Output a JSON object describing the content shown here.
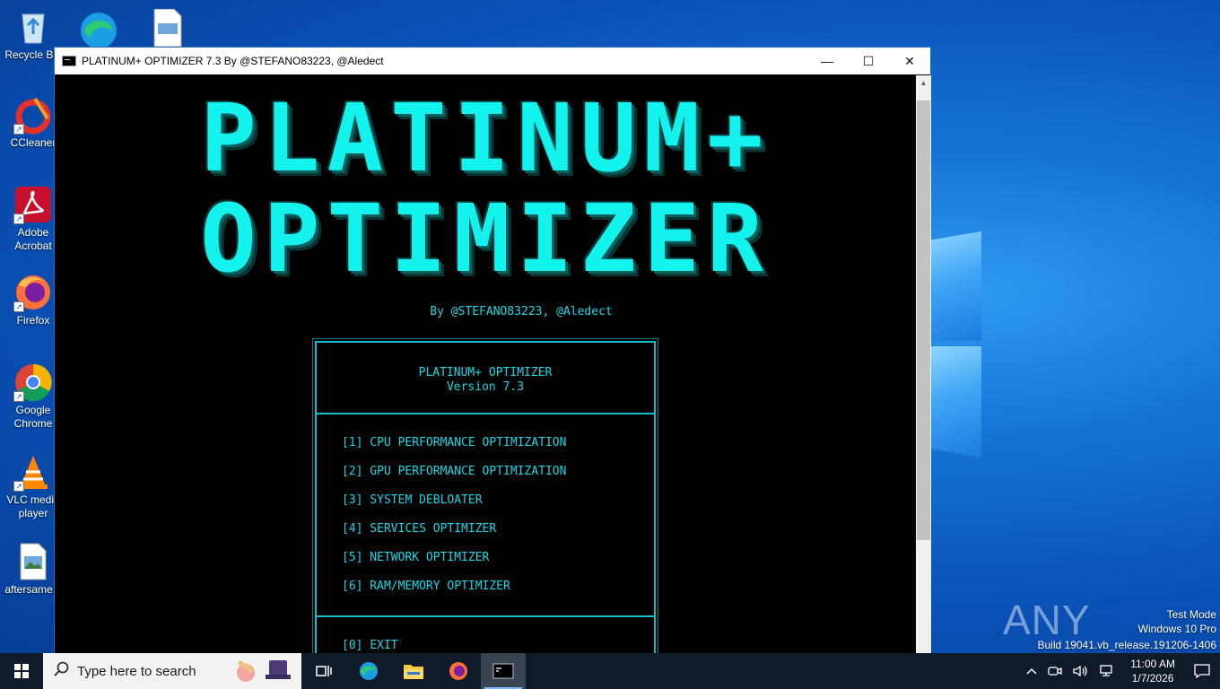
{
  "desktop": {
    "icons": [
      {
        "label": "Recycle Bin",
        "icon": "recycle-bin-icon"
      },
      {
        "label": "CCleaner",
        "icon": "ccleaner-icon"
      },
      {
        "label": "Adobe Acrobat",
        "icon": "acrobat-icon"
      },
      {
        "label": "Firefox",
        "icon": "firefox-icon"
      },
      {
        "label": "Google Chrome",
        "icon": "chrome-icon"
      },
      {
        "label": "VLC media player",
        "icon": "vlc-icon"
      },
      {
        "label": "aftersame...",
        "icon": "image-file-icon"
      }
    ],
    "watermark": "ANY RUN",
    "test_mode": [
      "Test Mode",
      "Windows 10 Pro",
      "Build 19041.vb_release.191206-1406"
    ]
  },
  "window": {
    "title": "PLATINUM+ OPTIMIZER 7.3 By @STEFANO83223, @Aledect",
    "controls": {
      "minimize": "—",
      "maximize": "☐",
      "close": "✕"
    }
  },
  "console": {
    "banner_line1": "PLATINUM+",
    "banner_line2": "OPTIMIZER",
    "byline": "By @STEFANO83223, @Aledect",
    "header_title": "PLATINUM+ OPTIMIZER",
    "header_version": "Version 7.3",
    "menu": [
      "[1] CPU PERFORMANCE OPTIMIZATION",
      "[2] GPU PERFORMANCE OPTIMIZATION",
      "[3] SYSTEM DEBLOATER",
      "[4] SERVICES OPTIMIZER",
      "[5] NETWORK OPTIMIZER",
      "[6] RAM/MEMORY OPTIMIZER"
    ],
    "exit": "[0] EXIT"
  },
  "taskbar": {
    "search_placeholder": "Type here to search",
    "time": "11:00 AM",
    "date": "1/7/2026"
  },
  "colors": {
    "console_cyan": "#14d9e6",
    "banner_cyan": "#14f2ee",
    "taskbar": "#101a28"
  }
}
